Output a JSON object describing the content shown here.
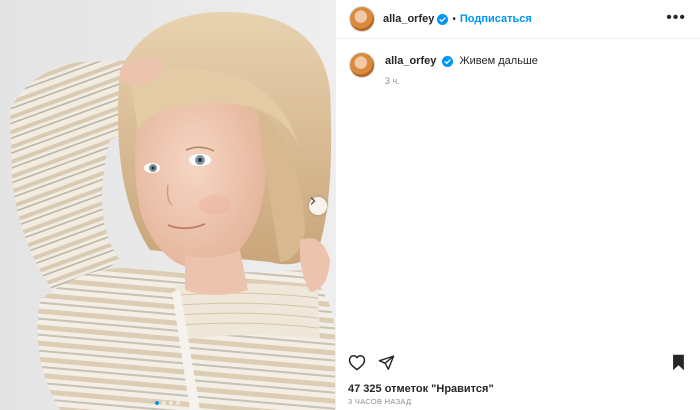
{
  "post": {
    "author": {
      "username": "alla_orfey",
      "verified": true,
      "avatar": "profile-photo"
    },
    "header": {
      "separator": "•",
      "follow_label": "Подписаться",
      "more_label": "•••"
    },
    "caption": {
      "username": "alla_orfey",
      "text": "Живем дальше",
      "time_short": "3 ч."
    },
    "media": {
      "type": "carousel",
      "slide_count": 4,
      "active_slide": 1,
      "description_icon": "photo-child"
    },
    "engagement": {
      "likes_text": "47 325 отметок \"Нравится\"",
      "time_ago": "3 ЧАСОВ НАЗАД"
    },
    "icons": {
      "like": "heart-icon",
      "share": "paper-plane-icon",
      "save": "bookmark-icon",
      "next": "chevron-right-icon",
      "verified": "verified-badge-icon"
    },
    "colors": {
      "accent": "#0095f6",
      "text": "#262626",
      "muted": "#8e8e8e",
      "border": "#efefef"
    }
  }
}
